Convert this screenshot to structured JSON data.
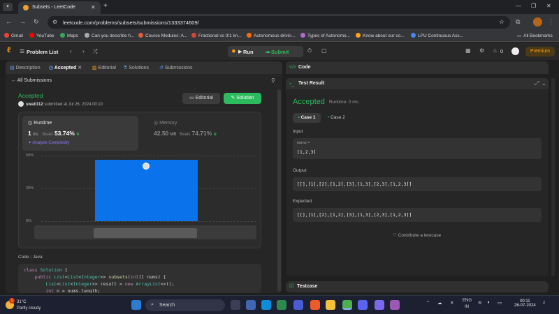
{
  "browser": {
    "tab_title": "Subsets - LeetCode",
    "url": "leetcode.com/problems/subsets/submissions/1333374609/",
    "bookmarks": [
      {
        "label": "Gmail",
        "color": "#ea4335"
      },
      {
        "label": "YouTube",
        "color": "#ff0000"
      },
      {
        "label": "Maps",
        "color": "#34a853"
      },
      {
        "label": "Can you describe h...",
        "color": "#aaaaaa"
      },
      {
        "label": "Course Modules: A...",
        "color": "#e25d33"
      },
      {
        "label": "Fractional vs 0/1 kn...",
        "color": "#d14836"
      },
      {
        "label": "Autonomous drivin...",
        "color": "#ff6a00"
      },
      {
        "label": "Types of Autonomo...",
        "color": "#b06ad0"
      },
      {
        "label": "Know about our co...",
        "color": "#ffa116"
      },
      {
        "label": "LPU Continuous Ass...",
        "color": "#4285f4"
      }
    ],
    "all_bookmarks": "All Bookmarks"
  },
  "nav": {
    "problem_list": "Problem List",
    "run": "Run",
    "submit": "Submit",
    "streak": "0",
    "premium": "Premium"
  },
  "left": {
    "tabs": [
      "Description",
      "Accepted",
      "Editorial",
      "Solutions",
      "Submissions"
    ],
    "all_submissions": "All Submissions",
    "status": "Accepted",
    "user": "swati112",
    "submitted": "submitted at Jul 26, 2024 00:10",
    "editorial_btn": "Editorial",
    "solution_btn": "Solution",
    "runtime": {
      "label": "Runtime",
      "value": "1",
      "unit": "ms",
      "beats_label": "Beats",
      "beats": "53.74%",
      "analyze": "Analyze Complexity"
    },
    "memory": {
      "label": "Memory",
      "value": "42.50",
      "unit": "MB",
      "beats_label": "Beats",
      "beats": "74.71%"
    },
    "code_header": "Code",
    "language": "Java"
  },
  "chart_data": {
    "type": "bar",
    "yticks": [
      "50%",
      "25%",
      "0%"
    ],
    "ylim": [
      0,
      50
    ],
    "values": [
      47
    ],
    "colors": {
      "bar": "#0a72ea"
    }
  },
  "code_lines": [
    "class Solution {",
    "    public List<List<Integer>> subsets(int[] nums) {",
    "        List<List<Integer>> result = new ArrayList<>();",
    "        int n = nums.length;"
  ],
  "right": {
    "code_title": "Code",
    "test_result_title": "Test Result",
    "status": "Accepted",
    "runtime": "Runtime: 0 ms",
    "case1": "Case 1",
    "case2": "Case 2",
    "input_label": "Input",
    "input_var": "nums =",
    "input_val": "[1,2,3]",
    "output_label": "Output",
    "output_val": "[[],[1],[2],[1,2],[3],[1,3],[2,3],[1,2,3]]",
    "expected_label": "Expected",
    "expected_val": "[[],[1],[2],[1,2],[3],[1,3],[2,3],[1,2,3]]",
    "contribute": "Contribute a testcase",
    "testcase_title": "Testcase"
  },
  "taskbar": {
    "temp": "31°C",
    "weather": "Partly cloudy",
    "search": "Search",
    "lang1": "ENG",
    "lang2": "IN",
    "time": "00:11",
    "date": "26-07-2024",
    "notif": "1"
  }
}
